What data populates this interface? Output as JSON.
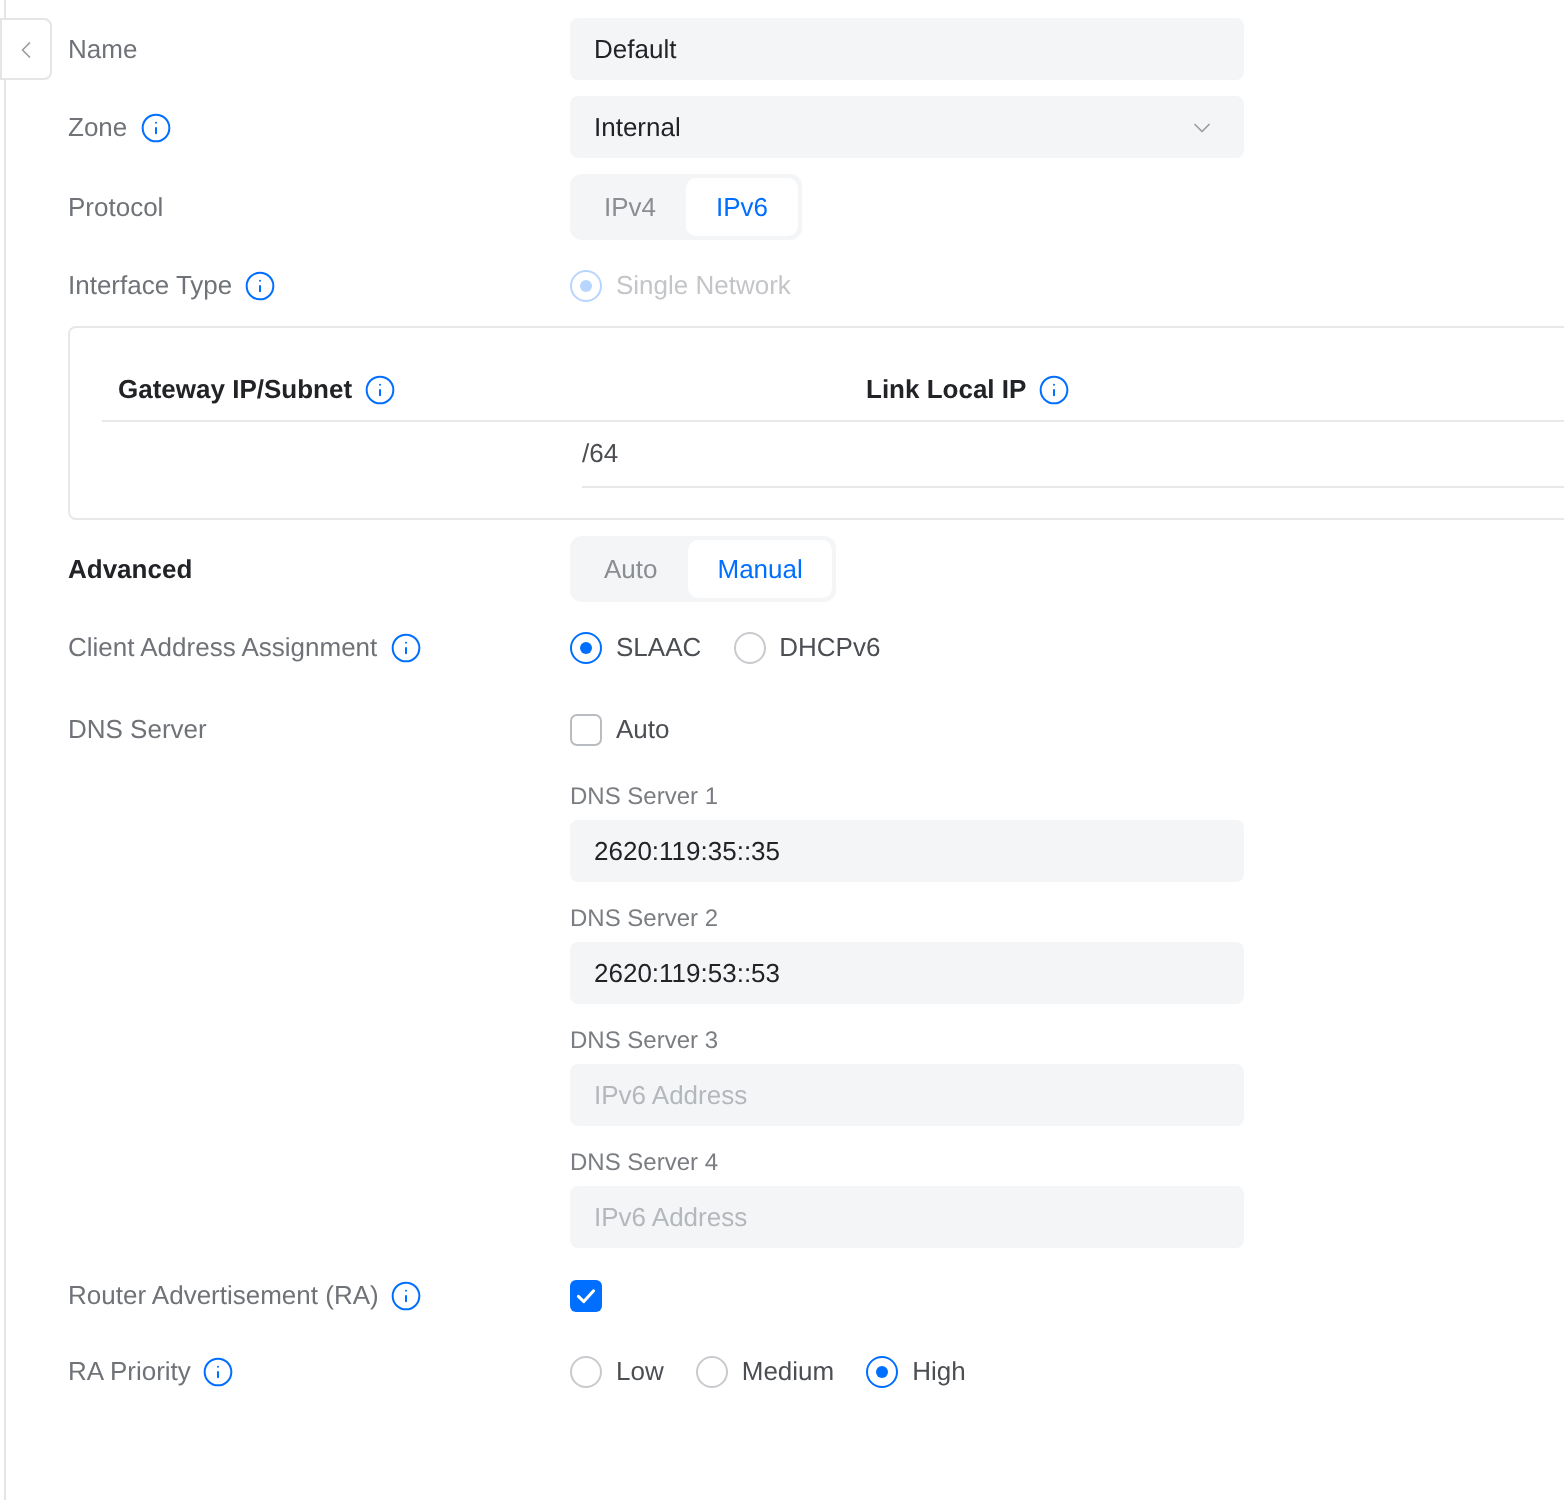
{
  "fields": [
    {
      "kind": "text",
      "label": "Name",
      "value": "Default"
    },
    {
      "kind": "select",
      "label": "Zone",
      "info": true,
      "value": "Internal"
    },
    {
      "kind": "segmented",
      "label": "Protocol",
      "options": [
        {
          "label": "IPv4",
          "selected": false
        },
        {
          "label": "IPv6",
          "selected": true
        }
      ]
    },
    {
      "kind": "radio",
      "label": "Interface Type",
      "info": true,
      "disabled": true,
      "options": [
        {
          "label": "Single Network",
          "selected": true
        }
      ]
    },
    {
      "kind": "table",
      "columns": [
        {
          "label": "Gateway IP/Subnet",
          "info": true
        },
        {
          "label": "Link Local IP",
          "info": true
        }
      ],
      "rows": [
        {
          "gateway_ip_subnet": "/64"
        }
      ]
    },
    {
      "kind": "segmented",
      "label": "Advanced",
      "label_bold": true,
      "options": [
        {
          "label": "Auto",
          "selected": false
        },
        {
          "label": "Manual",
          "selected": true
        }
      ]
    },
    {
      "kind": "radio",
      "label": "Client Address Assignment",
      "info": true,
      "options": [
        {
          "label": "SLAAC",
          "selected": true
        },
        {
          "label": "DHCPv6",
          "selected": false
        }
      ]
    },
    {
      "kind": "dns",
      "label": "DNS Server",
      "auto": {
        "label": "Auto",
        "checked": false
      },
      "servers": [
        {
          "label": "DNS Server 1",
          "value": "2620:119:35::35"
        },
        {
          "label": "DNS Server 2",
          "value": "2620:119:53::53"
        },
        {
          "label": "DNS Server 3",
          "placeholder": "IPv6 Address"
        },
        {
          "label": "DNS Server 4",
          "placeholder": "IPv6 Address"
        }
      ]
    },
    {
      "kind": "checkbox",
      "label": "Router Advertisement (RA)",
      "info": true,
      "checked": true
    },
    {
      "kind": "radio",
      "label": "RA Priority",
      "info": true,
      "options": [
        {
          "label": "Low",
          "selected": false
        },
        {
          "label": "Medium",
          "selected": false
        },
        {
          "label": "High",
          "selected": true
        }
      ]
    }
  ]
}
